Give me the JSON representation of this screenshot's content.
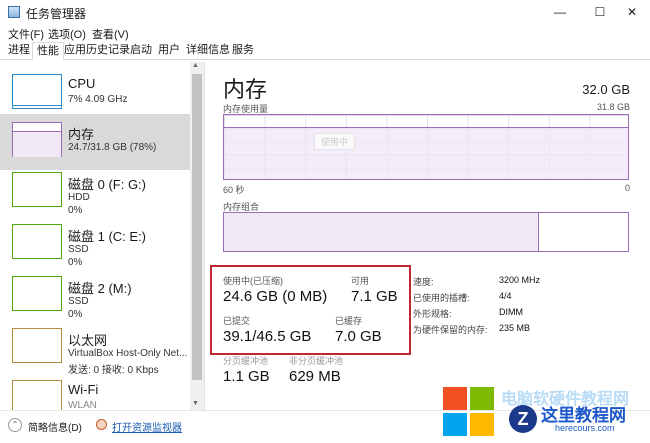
{
  "window": {
    "title": "任务管理器",
    "controls": {
      "minimize": "—",
      "maximize": "☐",
      "close": "✕"
    }
  },
  "menu": {
    "items": [
      "文件(F)",
      "选项(O)",
      "查看(V)"
    ]
  },
  "tabs": [
    "进程",
    "性能",
    "应用历史记录",
    "启动",
    "用户",
    "详细信息",
    "服务"
  ],
  "active_tab": "性能",
  "sidebar": {
    "items": [
      {
        "name": "CPU",
        "line1": "7% 4.09 GHz",
        "line2": ""
      },
      {
        "name": "内存",
        "line1": "24.7/31.8 GB (78%)",
        "line2": ""
      },
      {
        "name": "磁盘 0 (F: G:)",
        "line1": "HDD",
        "line2": "0%"
      },
      {
        "name": "磁盘 1 (C: E:)",
        "line1": "SSD",
        "line2": "0%"
      },
      {
        "name": "磁盘 2 (M:)",
        "line1": "SSD",
        "line2": "0%"
      },
      {
        "name": "以太网",
        "line1": "VirtualBox Host-Only Net...",
        "line2": "发送: 0 接收: 0 Kbps"
      },
      {
        "name": "Wi-Fi",
        "line1": "WLAN",
        "line2": ""
      }
    ],
    "selected_index": 1
  },
  "memory": {
    "title": "内存",
    "total": "32.0 GB",
    "usage_label": "内存使用量",
    "usage_max": "31.8 GB",
    "graph_watermark": "使用中",
    "axis_left": "60 秒",
    "axis_right": "0",
    "composition_label": "内存组合",
    "composition_used_fraction": 0.78,
    "stats": {
      "in_use_label": "使用中(已压缩)",
      "in_use_value": "24.6 GB (0 MB)",
      "available_label": "可用",
      "available_value": "7.1 GB",
      "committed_label": "已提交",
      "committed_value": "39.1/46.5 GB",
      "cached_label": "已缓存",
      "cached_value": "7.0 GB",
      "paged_label": "分页缓冲池",
      "paged_value": "1.1 GB",
      "nonpaged_label": "非分页缓冲池",
      "nonpaged_value": "629 MB"
    },
    "specs": [
      {
        "label": "速度:",
        "value": "3200 MHz"
      },
      {
        "label": "已使用的插槽:",
        "value": "4/4"
      },
      {
        "label": "外形规格:",
        "value": "DIMM"
      },
      {
        "label": "为硬件保留的内存:",
        "value": "235 MB"
      }
    ]
  },
  "statusbar": {
    "fewer_details": "简略信息(D)",
    "open_monitor": "打开资源监视器",
    "chevron": "⌃"
  },
  "watermark": {
    "ghost_text": "电脑软硬件教程网",
    "site_name": "这里教程网",
    "url": "herecours.com",
    "z_letter": "Z"
  },
  "colors": {
    "memory_accent": "#9b6bb8",
    "disk_accent": "#4da60c",
    "cpu_accent": "#2a8ccf",
    "highlight": "#c0282f"
  }
}
